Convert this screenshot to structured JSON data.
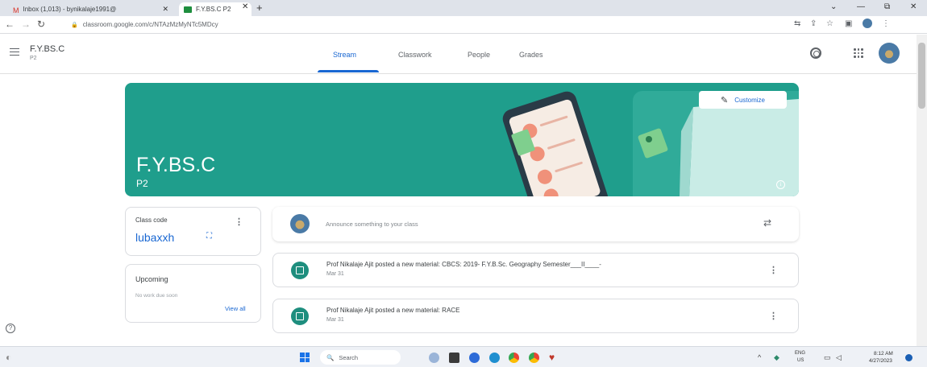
{
  "browser": {
    "tabs": [
      {
        "label": "Inbox (1,013) - bynikalaje1991@",
        "favicon": "gmail-icon"
      },
      {
        "label": "F.Y.BS.C P2",
        "favicon": "classroom-icon"
      }
    ],
    "url": "classroom.google.com/c/NTAzMzMyNTc5MDcy"
  },
  "header": {
    "class_name": "F.Y.BS.C",
    "section": "P2",
    "tabs": [
      "Stream",
      "Classwork",
      "People",
      "Grades"
    ],
    "active_tab": "Stream"
  },
  "banner": {
    "title": "F.Y.BS.C",
    "subtitle": "P2",
    "customize_label": "Customize",
    "color": "#1f9e8c"
  },
  "class_code": {
    "label": "Class code",
    "value": "lubaxxh"
  },
  "upcoming": {
    "title": "Upcoming",
    "empty": "No work due soon",
    "view_all": "View all"
  },
  "stream": {
    "announce_placeholder": "Announce something to your class",
    "posts": [
      {
        "text": "Prof Nikalaje Ajit posted a new material: CBCS: 2019- F.Y.B.Sc. Geography Semester___II____-",
        "date": "Mar 31"
      },
      {
        "text": "Prof Nikalaje Ajit posted a new material: RACE",
        "date": "Mar 31"
      }
    ]
  },
  "taskbar": {
    "search_label": "Search",
    "lang1": "ENG",
    "lang2": "US",
    "time": "8:12 AM",
    "date": "4/27/2023"
  }
}
